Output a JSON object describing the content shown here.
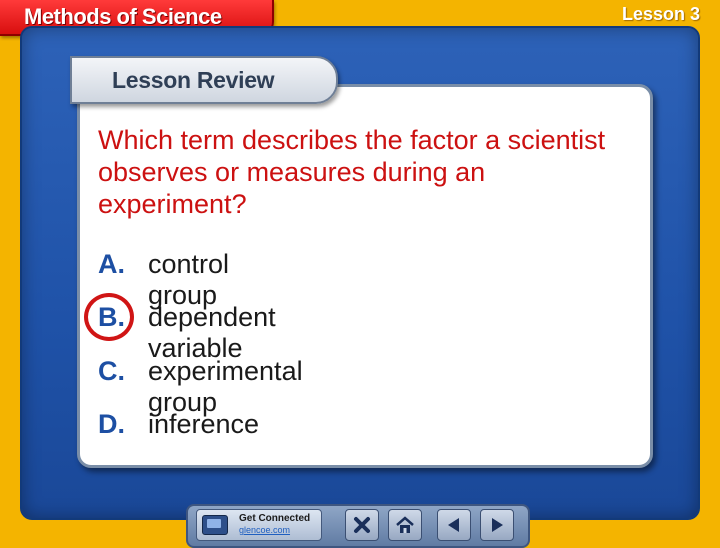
{
  "header": {
    "title": "Methods of Science",
    "lesson": "Lesson 3"
  },
  "panel": {
    "tab_label": "Lesson Review"
  },
  "question": "Which term describes the factor a scientist observes or measures during an experiment?",
  "answers": [
    {
      "letter": "A.",
      "text": "control group"
    },
    {
      "letter": "B.",
      "text": "dependent variable"
    },
    {
      "letter": "C.",
      "text": "experimental group"
    },
    {
      "letter": "D.",
      "text": "inference"
    }
  ],
  "selected_answer": "B.",
  "nav": {
    "get_connected_line1": "Get Connected",
    "get_connected_line2": "glencoe.com",
    "buttons": [
      "close-icon",
      "home-icon",
      "back-arrow-icon",
      "forward-arrow-icon"
    ]
  },
  "colors": {
    "background": "#f4b400",
    "title_tab": "#e01818",
    "frame": "#2358ad",
    "question_text": "#cc1111",
    "answer_letter": "#1d4fa3",
    "selection_circle": "#d01515"
  }
}
